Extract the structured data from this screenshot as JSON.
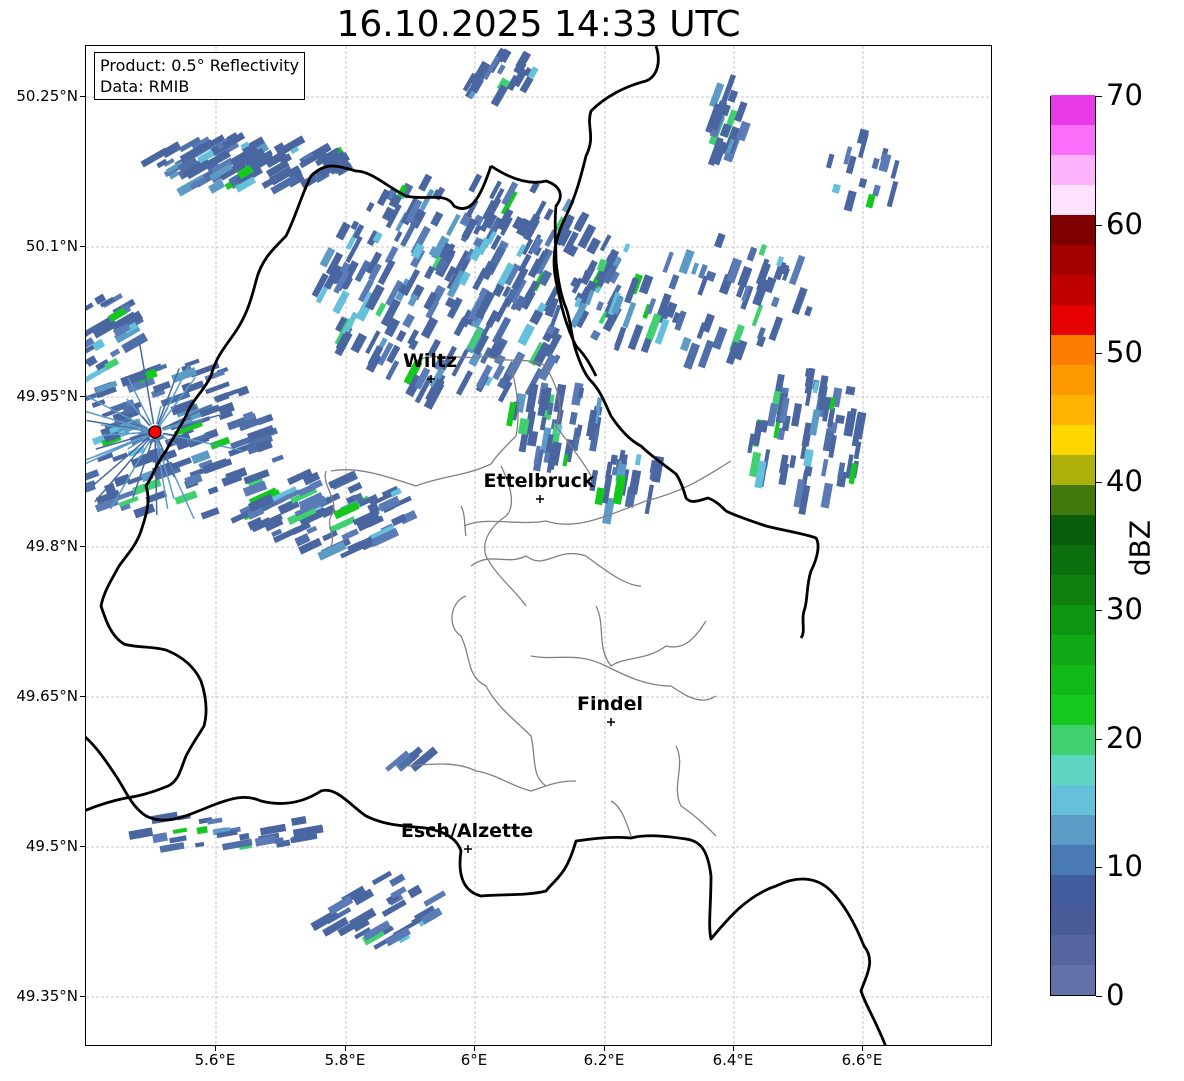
{
  "title": "16.10.2025 14:33 UTC",
  "infobox": {
    "product": "Product: 0.5° Reflectivity",
    "data": "Data: RMIB"
  },
  "axes": {
    "lat_labels": [
      "50.25°N",
      "50.1°N",
      "49.95°N",
      "49.8°N",
      "49.65°N",
      "49.5°N",
      "49.35°N"
    ],
    "lon_labels": [
      "5.6°E",
      "5.8°E",
      "6°E",
      "6.2°E",
      "6.4°E",
      "6.6°E"
    ],
    "gridlines": true
  },
  "cities": [
    {
      "name": "Wiltz"
    },
    {
      "name": "Ettelbruck"
    },
    {
      "name": "Findel"
    },
    {
      "name": "Esch/Alzette"
    }
  ],
  "colorbar": {
    "label": "dBZ",
    "ticks": [
      "0",
      "10",
      "20",
      "30",
      "40",
      "50",
      "60",
      "70"
    ],
    "min": 0,
    "max": 70,
    "step": 2.5,
    "colors": [
      "#6271a8",
      "#5565a0",
      "#4a5b9a",
      "#415c9e",
      "#4a7ab3",
      "#5b9bc6",
      "#65c0dc",
      "#5fd6c0",
      "#40d070",
      "#14c81e",
      "#11b81a",
      "#10a815",
      "#0f9512",
      "#0d8010",
      "#0b6f0d",
      "#095c09",
      "#427a10",
      "#aeb10a",
      "#fed600",
      "#fdb300",
      "#fd9a00",
      "#fd7d00",
      "#e60000",
      "#c00000",
      "#a30000",
      "#7e0000",
      "#ffe0fd",
      "#fcb3fc",
      "#fb6ef9",
      "#e83ae9"
    ]
  },
  "radar_marker": {
    "color": "#ff0000"
  }
}
